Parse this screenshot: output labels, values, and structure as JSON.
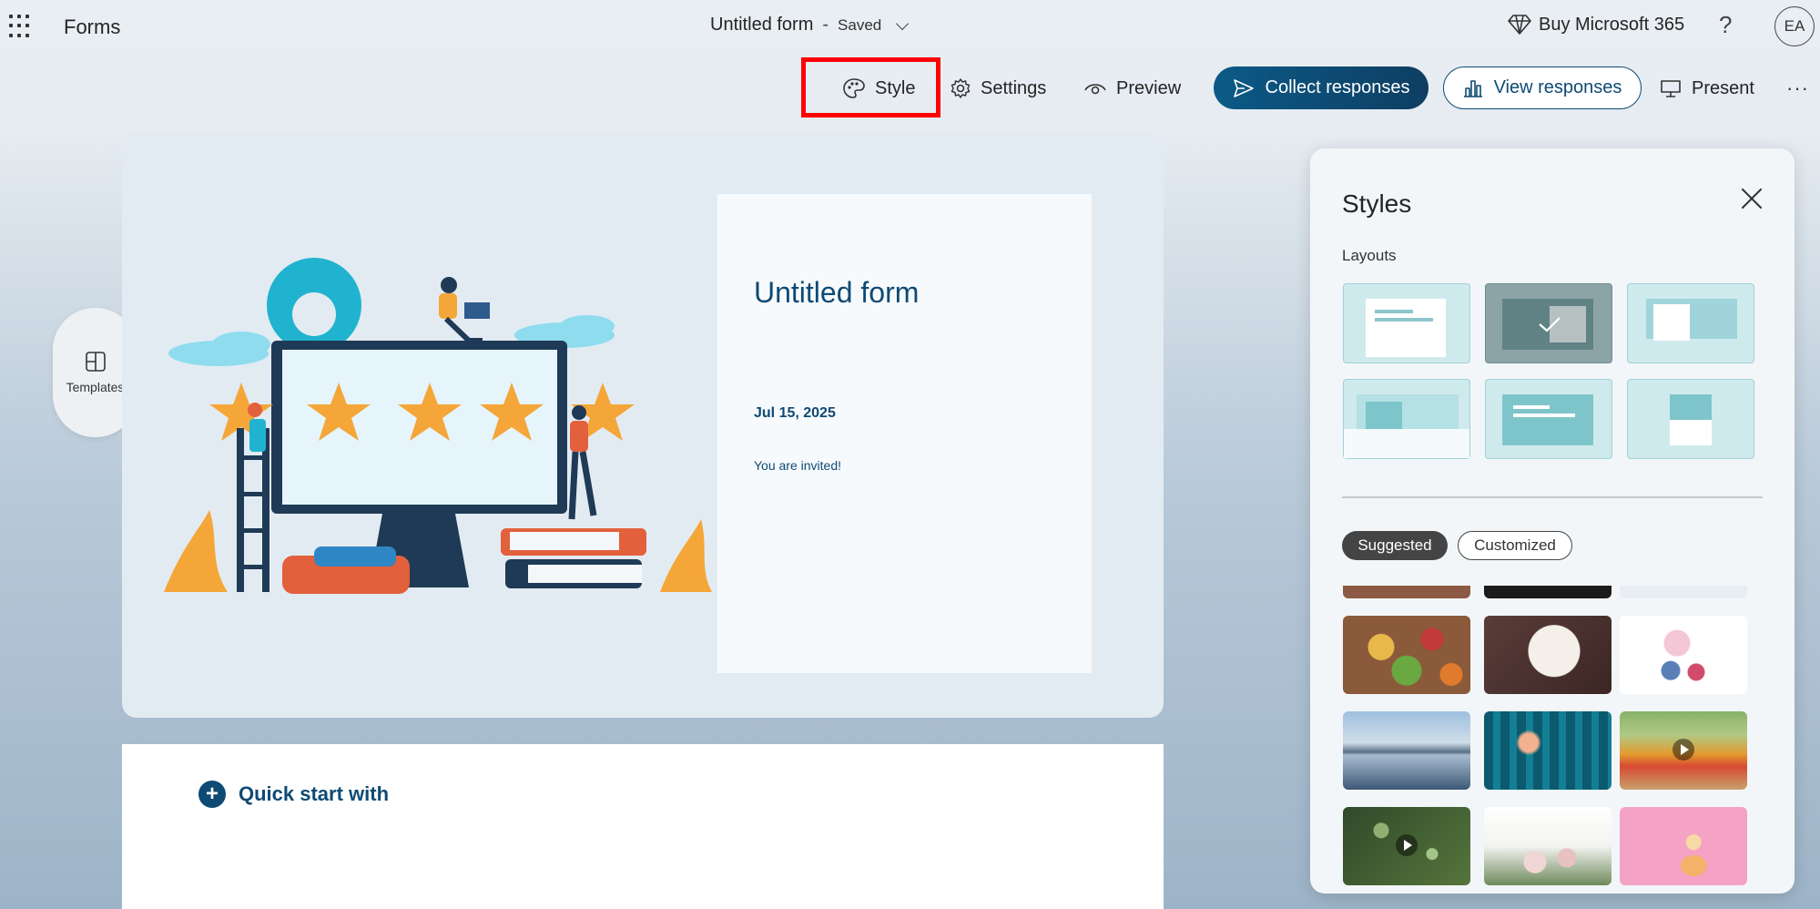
{
  "app": {
    "name": "Forms"
  },
  "header": {
    "form_title": "Untitled form",
    "separator": "-",
    "save_status": "Saved",
    "buy_label": "Buy Microsoft 365",
    "help_label": "?",
    "avatar_initials": "EA"
  },
  "toolbar": {
    "style_label": "Style",
    "settings_label": "Settings",
    "preview_label": "Preview",
    "collect_label": "Collect responses",
    "view_label": "View responses",
    "present_label": "Present",
    "more_label": "···"
  },
  "side": {
    "templates_label": "Templates"
  },
  "form": {
    "title": "Untitled form",
    "date": "Jul 15, 2025",
    "description": "You are invited!"
  },
  "quick_start": {
    "label": "Quick start with"
  },
  "styles_panel": {
    "title": "Styles",
    "layouts_label": "Layouts",
    "chip_suggested": "Suggested",
    "chip_customized": "Customized"
  },
  "colors": {
    "accent": "#0e4a74",
    "highlight": "#ff0000",
    "layout_fill": "#cfeaed",
    "layout_selected": "#7f9c9c"
  }
}
